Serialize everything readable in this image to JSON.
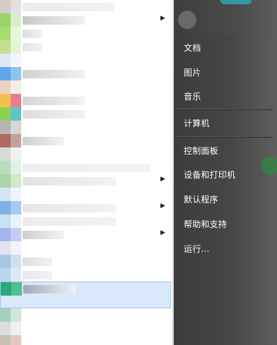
{
  "program_list": {
    "rows": [
      {
        "icon": [
          "#d7cbc5",
          "#e4e0df"
        ],
        "label_w": 130,
        "label_color": "#ececec",
        "arrow": false,
        "selected": false
      },
      {
        "icon": [
          "#9ad56a",
          "#d6f0c7"
        ],
        "label_w": 88,
        "label_color": "#c7c7c7",
        "arrow": true,
        "selected": false
      },
      {
        "icon": [
          "#a3df6d",
          "#e7f6dd"
        ],
        "label_w": 28,
        "label_color": "#dddddd",
        "arrow": false,
        "selected": false
      },
      {
        "icon": [
          "#c3e08e",
          "#e4f4d2"
        ],
        "label_w": 28,
        "label_color": "#e4e4e4",
        "arrow": false,
        "selected": false
      },
      {
        "icon": [
          "#dfe8f4",
          "#f3f6fa"
        ],
        "label_w": 0,
        "label_color": "#ffffff",
        "arrow": false,
        "selected": false
      },
      {
        "icon": [
          "#5fa9e8",
          "#8cc4f0"
        ],
        "label_w": 88,
        "label_color": "#d0d0d0",
        "arrow": false,
        "selected": false
      },
      {
        "icon": [
          "#ecd2c2",
          "#f6ebe6"
        ],
        "label_w": 0,
        "label_color": "#ffffff",
        "arrow": false,
        "selected": false
      },
      {
        "icon": [
          "#f2c04e",
          "#e77e8d"
        ],
        "label_w": 88,
        "label_color": "#d5d5d5",
        "arrow": false,
        "selected": false
      },
      {
        "icon": [
          "#8dd24f",
          "#5ec6c8"
        ],
        "label_w": 88,
        "label_color": "#dddddd",
        "arrow": false,
        "selected": false
      },
      {
        "icon": [
          "#b7b4b1",
          "#d8d6d4"
        ],
        "label_w": 0,
        "label_color": "#ffffff",
        "arrow": false,
        "selected": false
      },
      {
        "icon": [
          "#b06a62",
          "#c5a19d"
        ],
        "label_w": 58,
        "label_color": "#cfcfcf",
        "arrow": false,
        "selected": false
      },
      {
        "icon": [
          "#d6dcd4",
          "#eef1ed"
        ],
        "label_w": 0,
        "label_color": "#ffffff",
        "arrow": false,
        "selected": false
      },
      {
        "icon": [
          "#b9dcbf",
          "#e2f0e5"
        ],
        "label_w": 180,
        "label_color": "#efefef",
        "arrow": false,
        "selected": false
      },
      {
        "icon": [
          "#a9d7a6",
          "#cfe9cc"
        ],
        "label_w": 132,
        "label_color": "#e2e2e2",
        "arrow": true,
        "selected": false
      },
      {
        "icon": [
          "#d4e6f1",
          "#eef5fa"
        ],
        "label_w": 0,
        "label_color": "#ffffff",
        "arrow": false,
        "selected": false
      },
      {
        "icon": [
          "#7fb2e8",
          "#a8caf0"
        ],
        "label_w": 132,
        "label_color": "#e6e6e6",
        "arrow": true,
        "selected": false
      },
      {
        "icon": [
          "#c8e2f2",
          "#e8f3fa"
        ],
        "label_w": 132,
        "label_color": "#ececec",
        "arrow": false,
        "selected": false
      },
      {
        "icon": [
          "#a8b3ee",
          "#c6cdf4"
        ],
        "label_w": 58,
        "label_color": "#cfcfcf",
        "arrow": true,
        "selected": false
      },
      {
        "icon": [
          "#e2e3f0",
          "#f2f2f8"
        ],
        "label_w": 0,
        "label_color": "#ffffff",
        "arrow": false,
        "selected": false
      },
      {
        "icon": [
          "#a6c7e3",
          "#cfe0ee"
        ],
        "label_w": 42,
        "label_color": "#dcdcdc",
        "arrow": false,
        "selected": false
      },
      {
        "icon": [
          "#b9d6ec",
          "#dbeaf5"
        ],
        "label_w": 42,
        "label_color": "#e7e7e7",
        "arrow": false,
        "selected": false
      },
      {
        "icon": [
          "#2aa87a",
          "#52c08a"
        ],
        "label_w": 74,
        "label_color": "#9ea9b6",
        "arrow": false,
        "selected": true
      },
      {
        "icon": [
          "#a5d1c1",
          "#cfe7df"
        ],
        "label_w": 0,
        "label_color": "#ffffff",
        "arrow": false,
        "selected": false
      },
      {
        "icon": [
          "#dcdcdc",
          "#efefef"
        ],
        "label_w": 0,
        "label_color": "#ffffff",
        "arrow": false,
        "selected": false
      },
      {
        "icon": [
          "#c9c0b8",
          "#e5c6c1"
        ],
        "label_w": 0,
        "label_color": "#ffffff",
        "arrow": false,
        "selected": false
      },
      {
        "icon": [
          "#d8a3a3",
          "#e6c3c3"
        ],
        "label_w": 132,
        "label_color": "#cccccc",
        "arrow": false,
        "selected": false
      }
    ]
  },
  "right_panel": {
    "links": [
      {
        "id": "documents",
        "label": "文档"
      },
      {
        "id": "pictures",
        "label": "图片"
      },
      {
        "id": "music",
        "label": "音乐"
      },
      {
        "id": "computer",
        "label": "计算机"
      },
      {
        "id": "control_panel",
        "label": "控制面板"
      },
      {
        "id": "devices_printers",
        "label": "设备和打印机"
      },
      {
        "id": "default_programs",
        "label": "默认程序"
      },
      {
        "id": "help_support",
        "label": "帮助和支持"
      },
      {
        "id": "run",
        "label": "运行..."
      }
    ]
  },
  "colors": {
    "left_bg": "#ffffff",
    "right_bg": "#454545",
    "link_text": "#ffffff",
    "selection_border": "#9fc4ee"
  }
}
